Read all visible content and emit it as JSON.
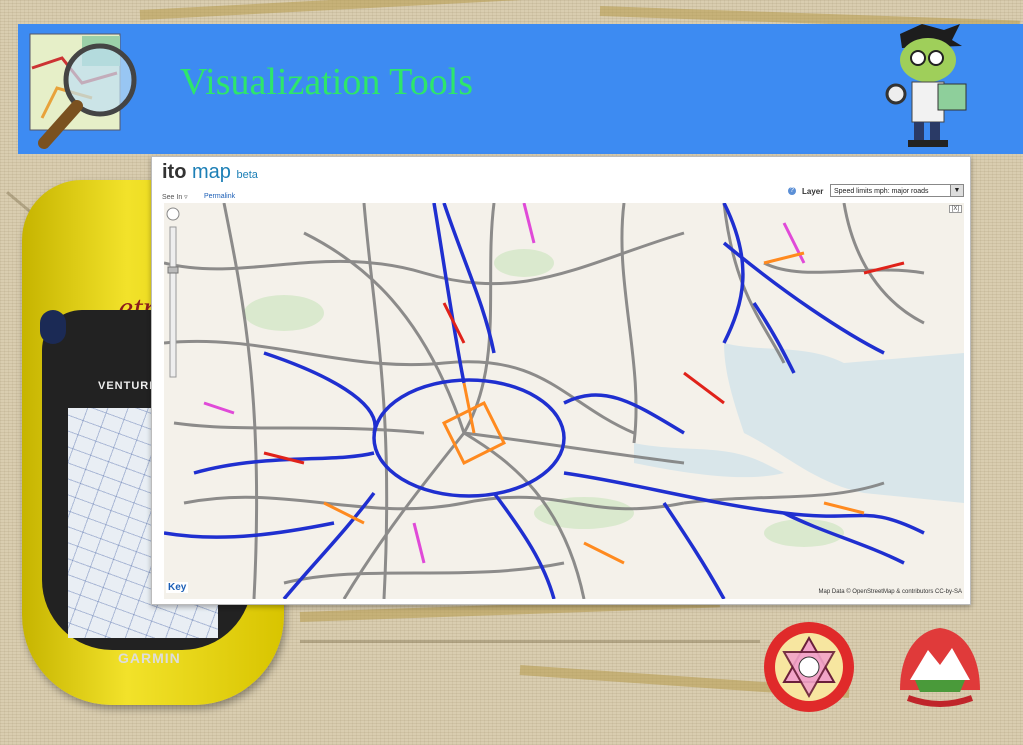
{
  "slide": {
    "title": "Visualization Tools"
  },
  "gps_device": {
    "brand_text": "GARMIN",
    "model_text": "VENTURE",
    "series_text": "etrex"
  },
  "map_app": {
    "brand_ito": "ito",
    "brand_map": "map",
    "brand_beta": "beta",
    "see_in_label": "See In ▿",
    "permalink_label": "Permalink",
    "layer_label": "Layer",
    "layer_selected": "Speed limits mph: major roads",
    "key_label": "Key",
    "attribution": "Map Data © OpenStreetMap & contributors CC-by-SA",
    "fullscreen_label": "[X]"
  },
  "colors": {
    "header_blue": "#3d8bf2",
    "title_green": "#2ee66b",
    "road_motorway": "#1f2fd0",
    "road_grey": "#7a7a7a",
    "road_orange": "#ff8a1f",
    "road_red": "#e0221a",
    "road_magenta": "#e04ad8",
    "sea": "#d9e6ea"
  },
  "icons": [
    "openstreetmap-magnifier-icon",
    "mascot-icon",
    "university-emblem-icon",
    "nepal-emblem-icon"
  ]
}
